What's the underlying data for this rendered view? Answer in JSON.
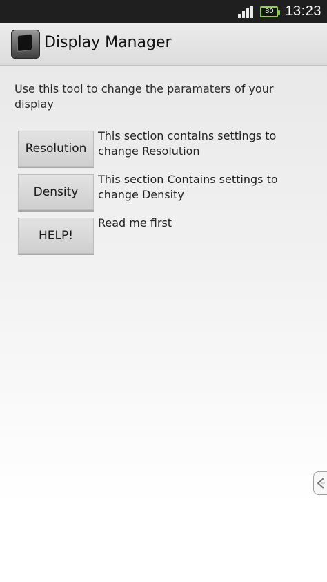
{
  "status_bar": {
    "battery_level": "80",
    "time": "13:23",
    "battery_color": "#8fd14f"
  },
  "action_bar": {
    "title": "Display Manager",
    "icon": "monitor-app-icon"
  },
  "main": {
    "intro_text": "Use this tool to change the paramaters of your display",
    "sections": [
      {
        "button_label": "Resolution",
        "description": "This section contains settings to change Resolution"
      },
      {
        "button_label": "Density",
        "description": "This section Contains settings to change Density"
      },
      {
        "button_label": "HELP!",
        "description": "Read me first"
      }
    ]
  },
  "edge_handle": {
    "icon": "chevron-left-icon"
  }
}
